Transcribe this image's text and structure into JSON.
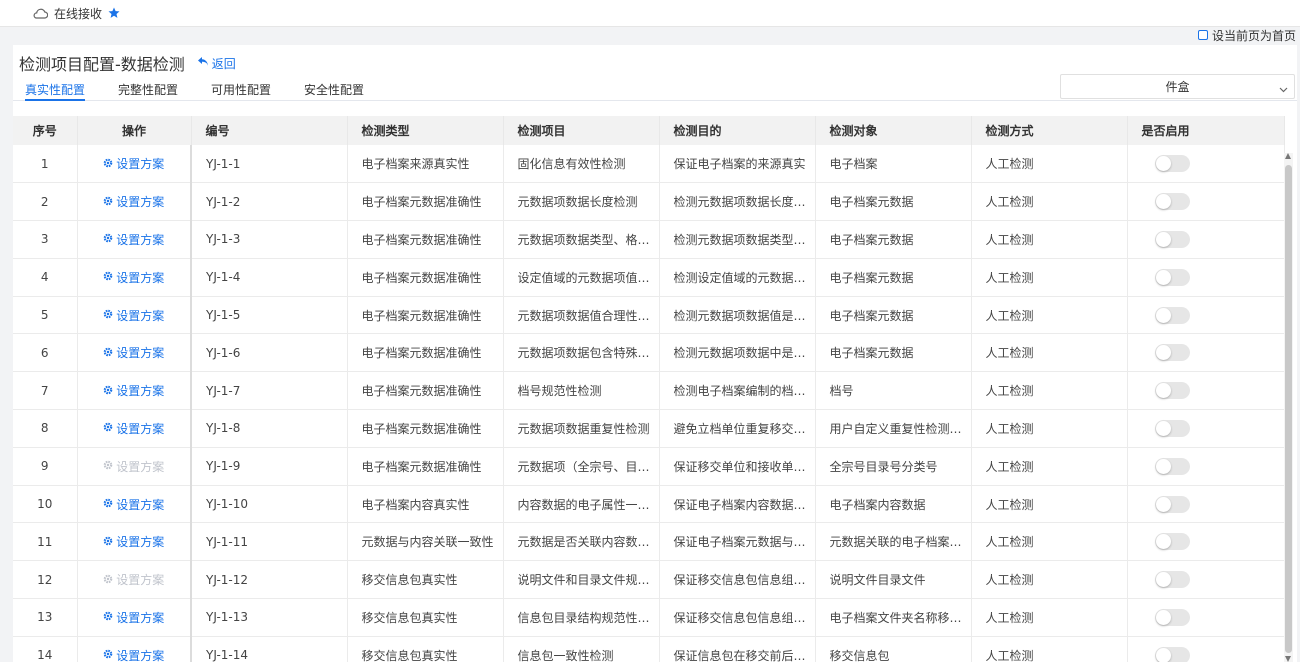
{
  "topbar": {
    "tab_label": "在线接收"
  },
  "homepage": {
    "label": "设当前页为首页"
  },
  "page": {
    "title": "检测项目配置-数据检测",
    "back_label": "返回"
  },
  "tabs": [
    "真实性配置",
    "完整性配置",
    "可用性配置",
    "安全性配置"
  ],
  "select": {
    "value": "件盒"
  },
  "table": {
    "headers": [
      "序号",
      "操作",
      "编号",
      "检测类型",
      "检测项目",
      "检测目的",
      "检测对象",
      "检测方式",
      "是否启用"
    ],
    "rows": [
      {
        "no": "1",
        "op": "设置方案",
        "op_enabled": true,
        "code": "YJ-1-1",
        "type": "电子档案来源真实性",
        "item": "固化信息有效性检测",
        "purpose": "保证电子档案的来源真实",
        "object": "电子档案",
        "method": "人工检测"
      },
      {
        "no": "2",
        "op": "设置方案",
        "op_enabled": true,
        "code": "YJ-1-2",
        "type": "电子档案元数据准确性",
        "item": "元数据项数据长度检测",
        "purpose": "检测元数据项数据长度是否符合要求",
        "object": "电子档案元数据",
        "method": "人工检测"
      },
      {
        "no": "3",
        "op": "设置方案",
        "op_enabled": true,
        "code": "YJ-1-3",
        "type": "电子档案元数据准确性",
        "item": "元数据项数据类型、格式检测",
        "purpose": "检测元数据项数据类型是否符合要求",
        "object": "电子档案元数据",
        "method": "人工检测"
      },
      {
        "no": "4",
        "op": "设置方案",
        "op_enabled": true,
        "code": "YJ-1-4",
        "type": "电子档案元数据准确性",
        "item": "设定值域的元数据项值检测",
        "purpose": "检测设定值域的元数据项值是否符合要求",
        "object": "电子档案元数据",
        "method": "人工检测"
      },
      {
        "no": "5",
        "op": "设置方案",
        "op_enabled": true,
        "code": "YJ-1-5",
        "type": "电子档案元数据准确性",
        "item": "元数据项数据值合理性检测",
        "purpose": "检测元数据项数据值是否合理",
        "object": "电子档案元数据",
        "method": "人工检测"
      },
      {
        "no": "6",
        "op": "设置方案",
        "op_enabled": true,
        "code": "YJ-1-6",
        "type": "电子档案元数据准确性",
        "item": "元数据项数据包含特殊字符检测",
        "purpose": "检测元数据项数据中是否包含特殊字符",
        "object": "电子档案元数据",
        "method": "人工检测"
      },
      {
        "no": "7",
        "op": "设置方案",
        "op_enabled": true,
        "code": "YJ-1-7",
        "type": "电子档案元数据准确性",
        "item": "档号规范性检测",
        "purpose": "检测电子档案编制的档号是否规范",
        "object": "档号",
        "method": "人工检测"
      },
      {
        "no": "8",
        "op": "设置方案",
        "op_enabled": true,
        "code": "YJ-1-8",
        "type": "电子档案元数据准确性",
        "item": "元数据项数据重复性检测",
        "purpose": "避免立档单位重复移交电子档案",
        "object": "用户自定义重复性检测字段",
        "method": "人工检测"
      },
      {
        "no": "9",
        "op": "设置方案",
        "op_enabled": false,
        "code": "YJ-1-9",
        "type": "电子档案元数据准确性",
        "item": "元数据项（全宗号、目录号）检测",
        "purpose": "保证移交单位和接收单位一致",
        "object": "全宗号目录号分类号",
        "method": "人工检测"
      },
      {
        "no": "10",
        "op": "设置方案",
        "op_enabled": true,
        "code": "YJ-1-10",
        "type": "电子档案内容真实性",
        "item": "内容数据的电子属性一致性检测",
        "purpose": "保证电子档案内容数据真实",
        "object": "电子档案内容数据",
        "method": "人工检测"
      },
      {
        "no": "11",
        "op": "设置方案",
        "op_enabled": true,
        "code": "YJ-1-11",
        "type": "元数据与内容关联一致性",
        "item": "元数据是否关联内容数据检测",
        "purpose": "保证电子档案元数据与内容数据关联",
        "object": "元数据关联的电子档案内容数据",
        "method": "人工检测"
      },
      {
        "no": "12",
        "op": "设置方案",
        "op_enabled": false,
        "code": "YJ-1-12",
        "type": "移交信息包真实性",
        "item": "说明文件和目录文件规范性检测",
        "purpose": "保证移交信息包信息组织规范",
        "object": "说明文件目录文件",
        "method": "人工检测"
      },
      {
        "no": "13",
        "op": "设置方案",
        "op_enabled": true,
        "code": "YJ-1-13",
        "type": "移交信息包真实性",
        "item": "信息包目录结构规范性检测",
        "purpose": "保证移交信息包信息组织规范",
        "object": "电子档案文件夹名称移交信息包",
        "method": "人工检测"
      },
      {
        "no": "14",
        "op": "设置方案",
        "op_enabled": true,
        "code": "YJ-1-14",
        "type": "移交信息包真实性",
        "item": "信息包一致性检测",
        "purpose": "保证信息包在移交前后一致",
        "object": "移交信息包",
        "method": "人工检测"
      }
    ]
  },
  "colors": {
    "accent": "#1a73e8",
    "disabled": "#c0c4cc",
    "header_bg": "#f2f2f2"
  },
  "icons": {
    "cloud": "cloud-icon",
    "star": "star-icon",
    "back": "reply-arrow-icon",
    "gear": "gear-icon",
    "chevron": "chevron-down-icon"
  }
}
